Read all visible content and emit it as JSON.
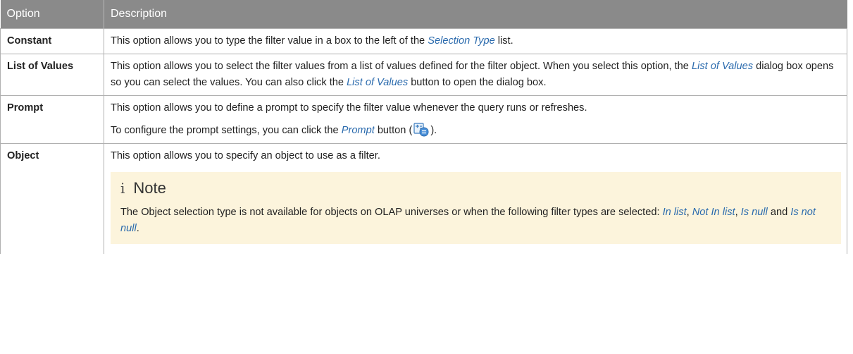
{
  "headers": {
    "option": "Option",
    "description": "Description"
  },
  "rows": {
    "constant": {
      "option": "Constant",
      "t1": "This option allows you to type the filter value in a box to the left of the ",
      "l1": "Selection Type",
      "t2": " list."
    },
    "list_of_values": {
      "option": "List of Values",
      "t1": "This option allows you to select the filter values from a list of values defined for the filter object. When you select this option, the ",
      "l1": "List of Values",
      "t2": " dialog box opens so you can select the values. You can also click the ",
      "l2": "List of Values",
      "t3": " button to open the dialog box."
    },
    "prompt": {
      "option": "Prompt",
      "p1": "This option allows you to define a prompt to specify the filter value whenever the query runs or refreshes.",
      "p2a": "To configure the prompt settings, you can click the ",
      "p2link": "Prompt",
      "p2b": " button (",
      "p2c": ").",
      "icon": "prompt-settings-icon"
    },
    "object": {
      "option": "Object",
      "p1": "This option allows you to specify an object to use as a filter.",
      "note": {
        "icon_glyph": "i",
        "title": "Note",
        "t1": "The Object selection type is not available for objects on OLAP universes or when the following filter types are selected: ",
        "l1": "In list",
        "s1": ", ",
        "l2": "Not In list",
        "s2": ", ",
        "l3": "Is null",
        "s3": " and ",
        "l4": "Is not null",
        "s4": "."
      }
    }
  },
  "colors": {
    "header_bg": "#8a8a8a",
    "link": "#2a6aad",
    "note_bg": "#fcf4dc",
    "border": "#b0b0b0"
  }
}
